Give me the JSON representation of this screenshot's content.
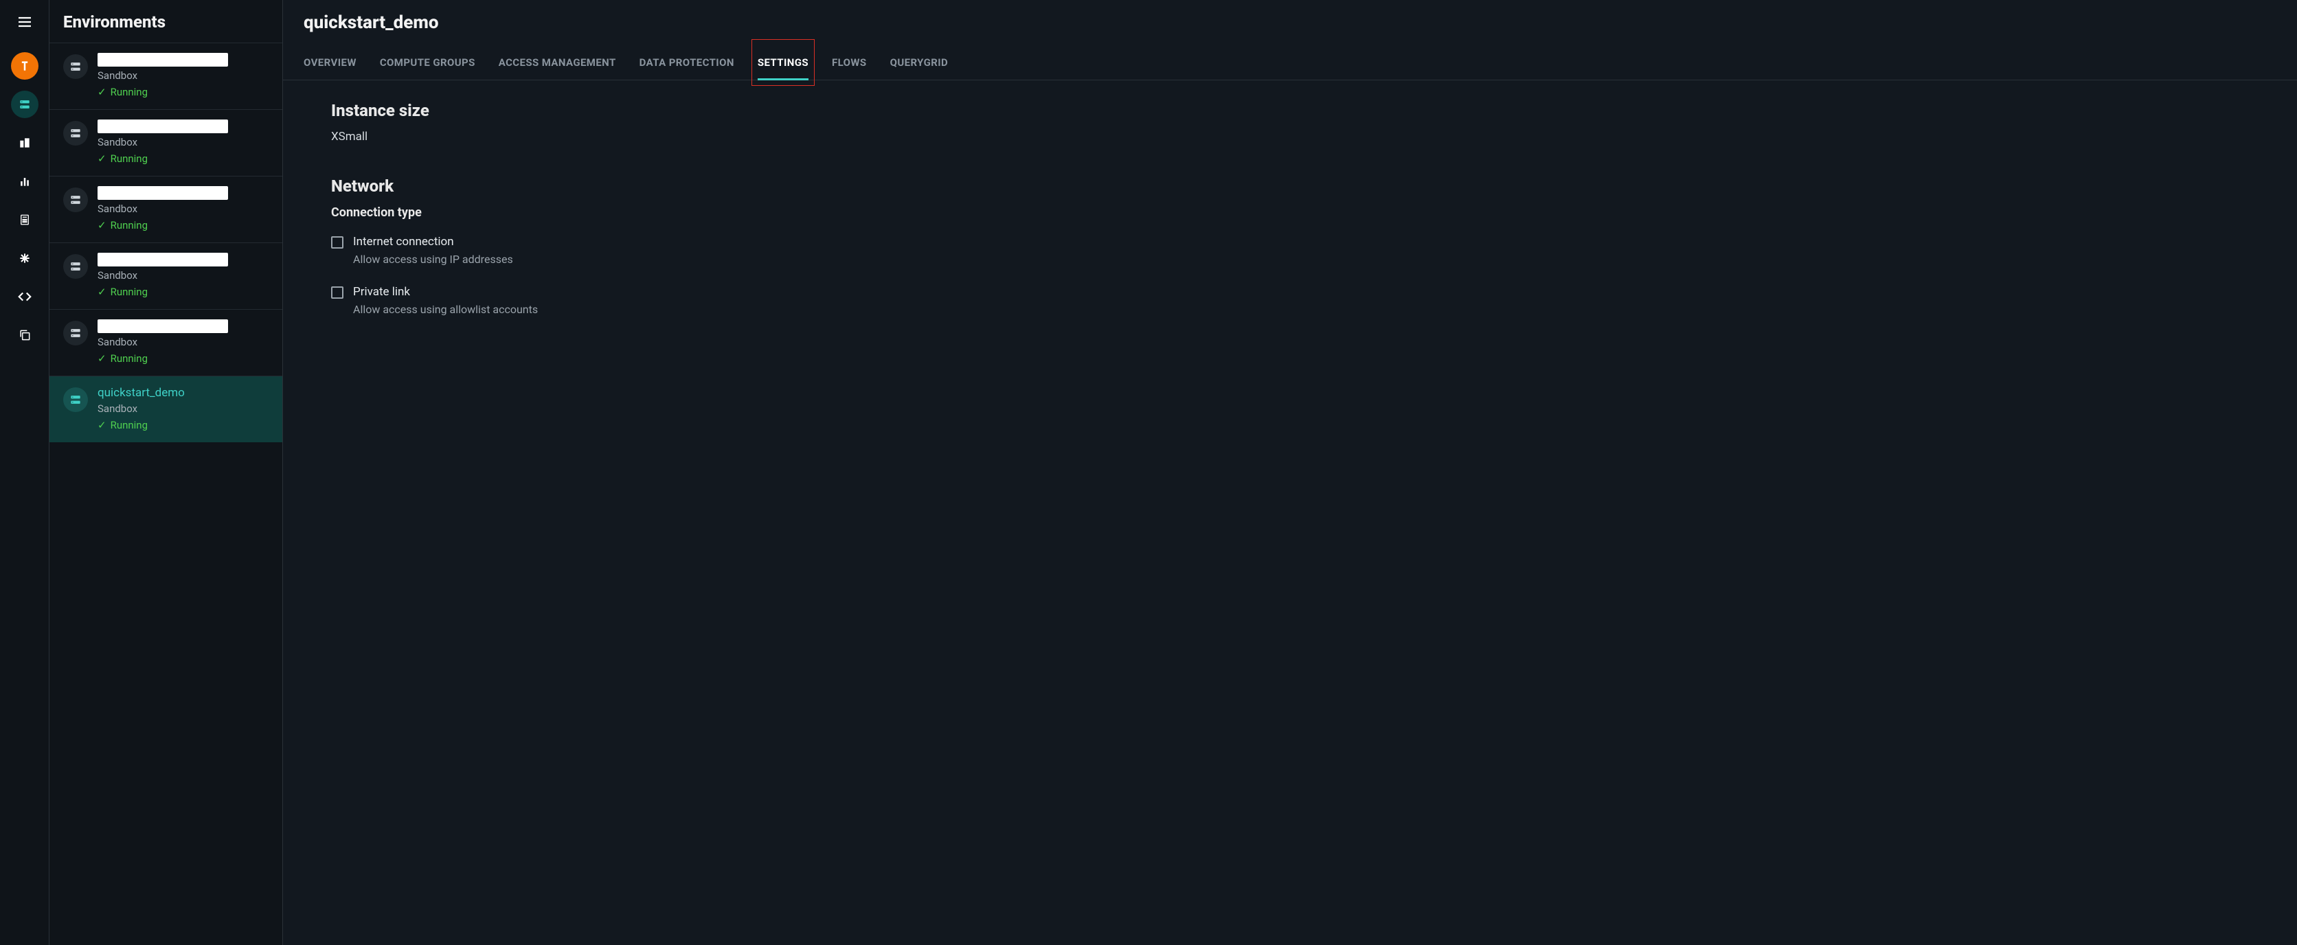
{
  "sidebar": {
    "title": "Environments",
    "items": [
      {
        "name": "",
        "redacted": true,
        "type": "Sandbox",
        "status": "Running",
        "selected": false
      },
      {
        "name": "",
        "redacted": true,
        "type": "Sandbox",
        "status": "Running",
        "selected": false
      },
      {
        "name": "",
        "redacted": true,
        "type": "Sandbox",
        "status": "Running",
        "selected": false
      },
      {
        "name": "",
        "redacted": true,
        "type": "Sandbox",
        "status": "Running",
        "selected": false
      },
      {
        "name": "",
        "redacted": true,
        "type": "Sandbox",
        "status": "Running",
        "selected": false
      },
      {
        "name": "quickstart_demo",
        "redacted": false,
        "type": "Sandbox",
        "status": "Running",
        "selected": true
      }
    ]
  },
  "main": {
    "title": "quickstart_demo",
    "tabs": [
      {
        "label": "OVERVIEW",
        "active": false,
        "highlighted": false
      },
      {
        "label": "COMPUTE GROUPS",
        "active": false,
        "highlighted": false
      },
      {
        "label": "ACCESS MANAGEMENT",
        "active": false,
        "highlighted": false
      },
      {
        "label": "DATA PROTECTION",
        "active": false,
        "highlighted": false
      },
      {
        "label": "SETTINGS",
        "active": true,
        "highlighted": true
      },
      {
        "label": "FLOWS",
        "active": false,
        "highlighted": false
      },
      {
        "label": "QUERYGRID",
        "active": false,
        "highlighted": false
      }
    ],
    "instance_size": {
      "heading": "Instance size",
      "value": "XSmall"
    },
    "network": {
      "heading": "Network",
      "connection_type_label": "Connection type",
      "options": [
        {
          "label": "Internet connection",
          "desc": "Allow access using IP addresses",
          "checked": false
        },
        {
          "label": "Private link",
          "desc": "Allow access using allowlist accounts",
          "checked": false
        }
      ]
    }
  },
  "rail": {
    "icons": [
      {
        "name": "brand-icon",
        "type": "brand"
      },
      {
        "name": "environments-icon",
        "type": "active"
      },
      {
        "name": "org-icon",
        "type": "normal"
      },
      {
        "name": "analytics-icon",
        "type": "normal"
      },
      {
        "name": "calculator-icon",
        "type": "normal"
      },
      {
        "name": "asterisk-icon",
        "type": "normal"
      },
      {
        "name": "code-icon",
        "type": "normal"
      },
      {
        "name": "copy-icon",
        "type": "normal"
      }
    ]
  }
}
